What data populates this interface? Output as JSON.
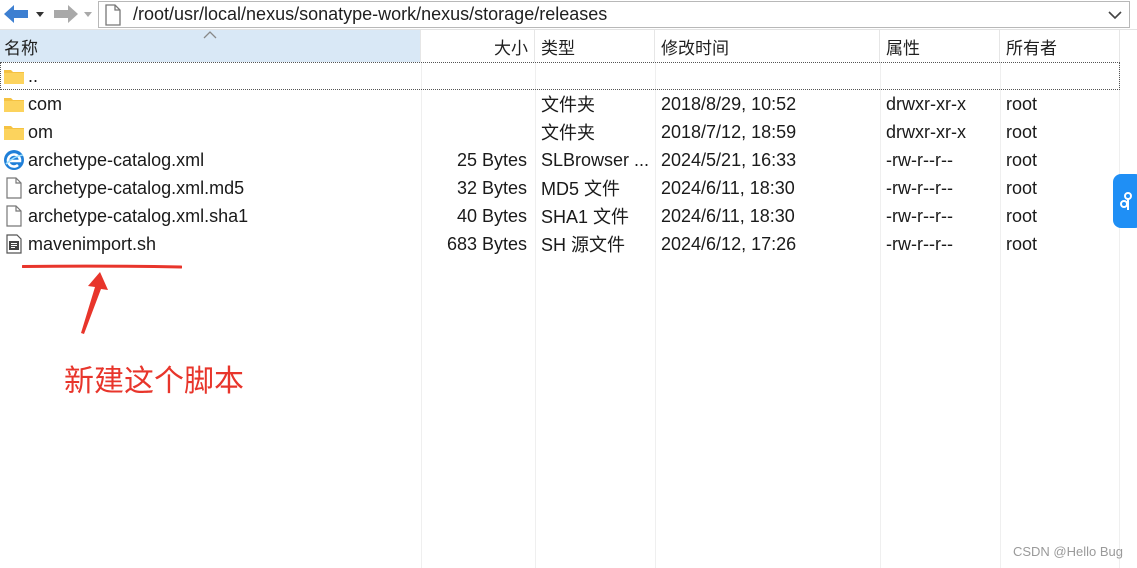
{
  "toolbar": {
    "path": "/root/usr/local/nexus/sonatype-work/nexus/storage/releases"
  },
  "columns": {
    "name": "名称",
    "size": "大小",
    "type": "类型",
    "modified": "修改时间",
    "attributes": "属性",
    "owner": "所有者"
  },
  "rows": [
    {
      "icon": "folder-icon",
      "name": "..",
      "size": "",
      "type": "",
      "modified": "",
      "attributes": "",
      "owner": ""
    },
    {
      "icon": "folder-icon",
      "name": "com",
      "size": "",
      "type": "文件夹",
      "modified": "2018/8/29, 10:52",
      "attributes": "drwxr-xr-x",
      "owner": "root"
    },
    {
      "icon": "folder-icon",
      "name": "om",
      "size": "",
      "type": "文件夹",
      "modified": "2018/7/12, 18:59",
      "attributes": "drwxr-xr-x",
      "owner": "root"
    },
    {
      "icon": "browser-file-icon",
      "name": "archetype-catalog.xml",
      "size": "25 Bytes",
      "type": "SLBrowser ...",
      "modified": "2024/5/21, 16:33",
      "attributes": "-rw-r--r--",
      "owner": "root"
    },
    {
      "icon": "blank-file-icon",
      "name": "archetype-catalog.xml.md5",
      "size": "32 Bytes",
      "type": "MD5 文件",
      "modified": "2024/6/11, 18:30",
      "attributes": "-rw-r--r--",
      "owner": "root"
    },
    {
      "icon": "blank-file-icon",
      "name": "archetype-catalog.xml.sha1",
      "size": "40 Bytes",
      "type": "SHA1 文件",
      "modified": "2024/6/11, 18:30",
      "attributes": "-rw-r--r--",
      "owner": "root"
    },
    {
      "icon": "script-file-icon",
      "name": "mavenimport.sh",
      "size": "683 Bytes",
      "type": "SH 源文件",
      "modified": "2024/6/12, 17:26",
      "attributes": "-rw-r--r--",
      "owner": "root"
    }
  ],
  "annotation": {
    "text": "新建这个脚本",
    "color": "#e8352b"
  },
  "watermark": "CSDN @Hello Bug",
  "colors": {
    "header_selected": "#d9e8f6",
    "folder": "#f5c242",
    "nav_arrow": "#3d7fd1",
    "side_tab": "#1f8ff5"
  }
}
